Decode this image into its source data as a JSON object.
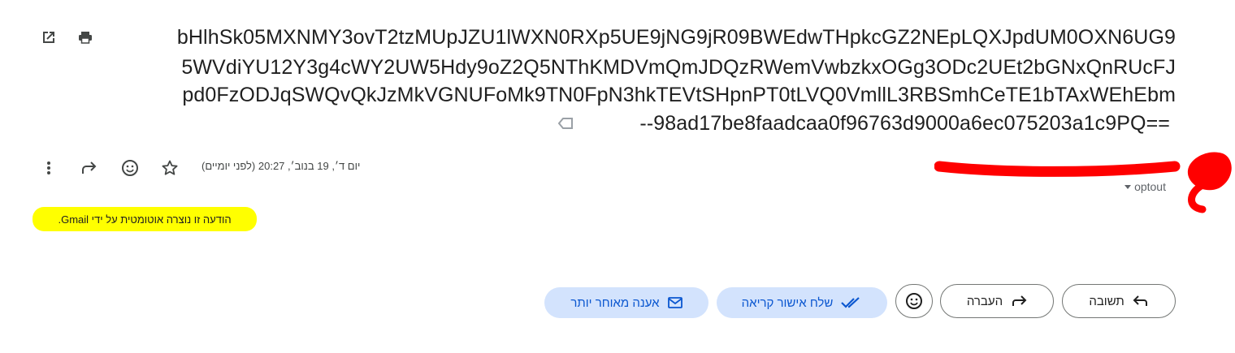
{
  "subject": {
    "line1": "bHlhSk05MXNMY3ovT2tzMUpJZU1lWXN0RXp5UE9jNG9jR09BWEdwTHpkcGZ2NEpLQXJpdUM0OXN6UG9",
    "line2": "5WVdiYU12Y3g4cWY2UW5Hdy9oZ2Q5NThKMDVmQmJDQzRWemVwbzkxOGg3ODc2UEt2bGNxQnRUcFJ",
    "line3": "pd0FzODJqSWQvQkJzMkVGNUFoMk9TN0FpN3hkTEVtSHpnPT0tLVQ0VmllL3RBSmhCeTE1bTAxWEhEbm",
    "line4": "--98ad17be8faadcaa0f96763d9000a6ec075203a1c9PQ=="
  },
  "header": {
    "date": "יום ד׳, 19 בנוב׳, 20:27 (לפני יומיים)",
    "optout": "optout"
  },
  "body": {
    "note": "הודעה זו נוצרה אוטומטית על ידי Gmail."
  },
  "actions": {
    "reply": "תשובה",
    "forward": "העברה",
    "send_receipt": "שלח אישור קריאה",
    "reply_later": "אענה מאוחר יותר"
  },
  "icons": {
    "open_new_window": "open-in-new-window-icon",
    "print": "print-icon",
    "label_tag": "label-tag-icon",
    "more": "more-vertical-icon",
    "forward": "forward-icon",
    "emoji": "emoji-icon",
    "star": "star-icon"
  },
  "colors": {
    "accent": "#0b57d0",
    "chip_bg": "#d3e3fd",
    "highlight": "#ffff00",
    "redaction": "#ff0000"
  }
}
